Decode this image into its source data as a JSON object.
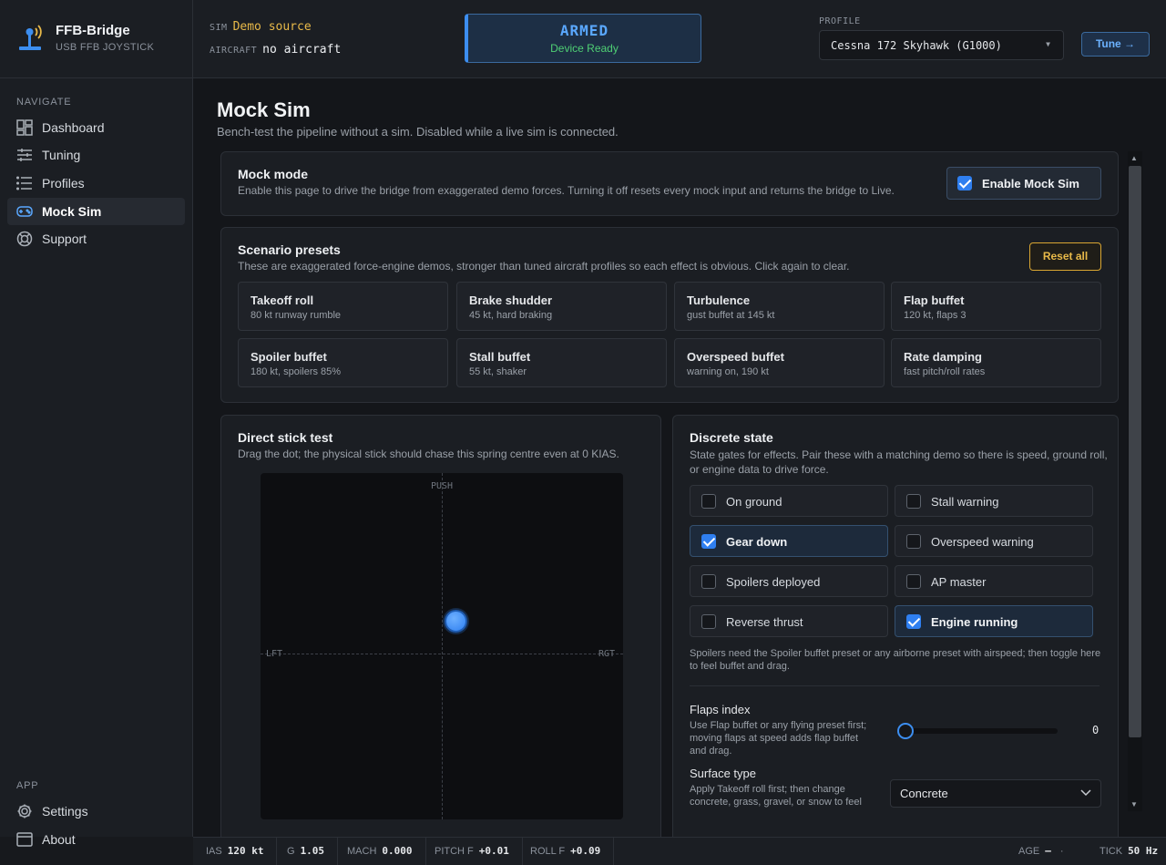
{
  "brand": {
    "name": "FFB-Bridge",
    "subtitle": "USB FFB JOYSTICK"
  },
  "context": {
    "sim_label": "SIM",
    "sim_value": "Demo source",
    "aircraft_label": "AIRCRAFT",
    "aircraft_value": "no aircraft"
  },
  "armed": {
    "title": "ARMED",
    "status": "Device Ready"
  },
  "profile": {
    "label": "PROFILE",
    "value": "Cessna 172 Skyhawk (G1000)"
  },
  "tune_label": "Tune →",
  "nav": {
    "heading": "NAVIGATE",
    "items": [
      {
        "label": "Dashboard",
        "icon": "dashboard-icon"
      },
      {
        "label": "Tuning",
        "icon": "sliders-icon"
      },
      {
        "label": "Profiles",
        "icon": "list-icon"
      },
      {
        "label": "Mock Sim",
        "icon": "gamepad-icon",
        "active": true
      },
      {
        "label": "Support",
        "icon": "lifebuoy-icon"
      }
    ],
    "app_heading": "APP",
    "app_items": [
      {
        "label": "Settings",
        "icon": "gear-icon"
      },
      {
        "label": "About",
        "icon": "window-icon"
      }
    ]
  },
  "page": {
    "title": "Mock Sim",
    "subtitle": "Bench-test the pipeline without a sim. Disabled while a live sim is connected."
  },
  "mock_mode": {
    "title": "Mock mode",
    "desc": "Enable this page to drive the bridge from exaggerated demo forces. Turning it off resets every mock input and returns the bridge to Live.",
    "toggle_label": "Enable Mock Sim",
    "enabled": true
  },
  "scenarios": {
    "title": "Scenario presets",
    "desc": "These are exaggerated force-engine demos, stronger than tuned aircraft profiles so each effect is obvious. Click again to clear.",
    "reset_label": "Reset all",
    "presets": [
      {
        "name": "Takeoff roll",
        "desc": "80 kt runway rumble"
      },
      {
        "name": "Brake shudder",
        "desc": "45 kt, hard braking"
      },
      {
        "name": "Turbulence",
        "desc": "gust buffet at 145 kt"
      },
      {
        "name": "Flap buffet",
        "desc": "120 kt, flaps 3"
      },
      {
        "name": "Spoiler buffet",
        "desc": "180 kt, spoilers 85%"
      },
      {
        "name": "Stall buffet",
        "desc": "55 kt, shaker"
      },
      {
        "name": "Overspeed buffet",
        "desc": "warning on, 190 kt"
      },
      {
        "name": "Rate damping",
        "desc": "fast pitch/roll rates"
      }
    ]
  },
  "stick": {
    "title": "Direct stick test",
    "desc": "Drag the dot; the physical stick should chase this spring centre even at 0 KIAS.",
    "label_push": "PUSH",
    "label_left": "LFT",
    "label_right": "RGT"
  },
  "discrete": {
    "title": "Discrete state",
    "desc": "State gates for effects. Pair these with a matching demo so there is speed, ground roll, or engine data to drive force.",
    "states": [
      {
        "label": "On ground",
        "checked": false
      },
      {
        "label": "Stall warning",
        "checked": false
      },
      {
        "label": "Gear down",
        "checked": true
      },
      {
        "label": "Overspeed warning",
        "checked": false
      },
      {
        "label": "Spoilers deployed",
        "checked": false
      },
      {
        "label": "AP master",
        "checked": false
      },
      {
        "label": "Reverse thrust",
        "checked": false
      },
      {
        "label": "Engine running",
        "checked": true
      }
    ],
    "note": "Spoilers need the Spoiler buffet preset or any airborne preset with airspeed; then toggle here to feel buffet and drag.",
    "flaps_label": "Flaps index",
    "flaps_desc": "Use Flap buffet or any flying preset first; moving flaps at speed adds flap buffet and drag.",
    "flaps_value": "0",
    "surface_label": "Surface type",
    "surface_desc": "Apply Takeoff roll first; then change concrete, grass, gravel, or snow to feel",
    "surface_value": "Concrete"
  },
  "status": {
    "ias_label": "IAS",
    "ias_value": "120 kt",
    "g_label": "G",
    "g_value": "1.05",
    "mach_label": "MACH",
    "mach_value": "0.000",
    "pitch_label": "PITCH F",
    "pitch_value": "+0.01",
    "roll_label": "ROLL F",
    "roll_value": "+0.09",
    "age_label": "AGE",
    "age_value": "—",
    "sep": "·",
    "tick_label": "TICK",
    "tick_value": "50 Hz"
  }
}
